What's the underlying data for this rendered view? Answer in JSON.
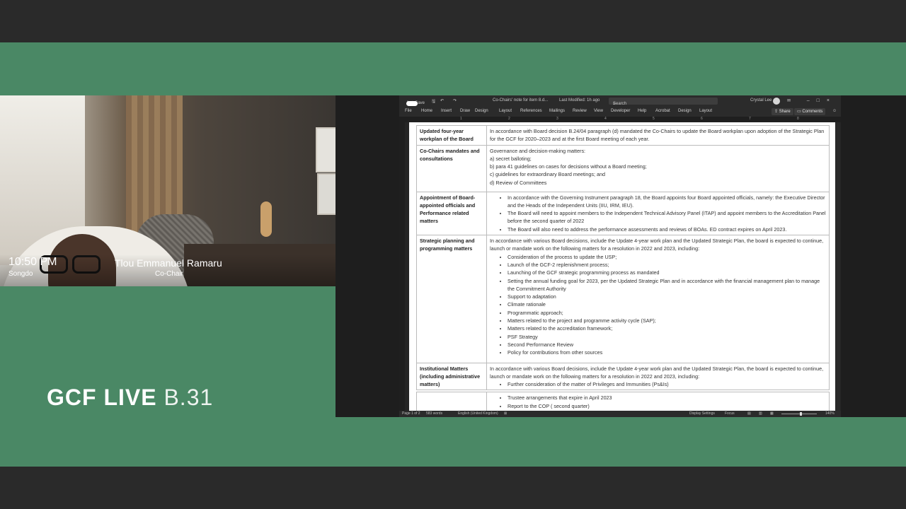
{
  "video": {
    "time": "10:50 PM",
    "city": "Songdo",
    "name": "Tlou Emmanuel Ramaru",
    "role": "Co-Chair"
  },
  "brand": {
    "main": "GCF LIVE",
    "suffix": "B.31"
  },
  "word": {
    "autosave": "AutoSave",
    "toggle": "On",
    "doc_title": "Co-Chairs' note for item 8.d...",
    "last_modified": "Last Modified: 1h ago",
    "search": "Search",
    "user": "Crystal Lee",
    "menus": [
      "File",
      "Home",
      "Insert",
      "Draw",
      "Design",
      "Layout",
      "References",
      "Mailings",
      "Review",
      "View",
      "Developer",
      "Help",
      "Acrobat",
      "Design",
      "Layout"
    ],
    "share": "Share",
    "comments": "Comments",
    "ruler_numbers": [
      "1",
      "2",
      "3",
      "4",
      "5",
      "6",
      "7",
      "8"
    ],
    "status": {
      "page": "Page 1 of 2",
      "words": "583 words",
      "language": "English (United Kingdom)",
      "display": "Display Settings",
      "focus": "Focus",
      "zoom": "140%"
    }
  },
  "doc": {
    "rows": [
      {
        "heading": "Updated four-year workplan of the Board",
        "text": "In accordance with Board decision B.24/04 paragraph (d) mandated the Co-Chairs to update the Board workplan upon adoption of the Strategic Plan for the GCF for 2020–2023 and at the first Board meeting of each year."
      },
      {
        "heading": "Co-Chairs mandates and consultations",
        "lines": [
          "Governance and decision-making matters:",
          "a) secret balloting;",
          "b) para 41 guidelines on cases for decisions without a Board meeting;",
          "c) guidelines for extraordinary Board meetings; and",
          "d) Review of Committees"
        ]
      },
      {
        "heading": "Appointment of Board-appointed officials and Performance related matters",
        "bullets": [
          "In accordance with the Governing Instrument paragraph 18, the Board appoints four Board appointed officials, namely: the Executive Director and the Heads of the Independent Units (IIU, IRM, IEU).",
          "The Board will need to appoint members to the Independent Technical Advisory Panel (ITAP) and appoint members to the Accreditation Panel before the second quarter of 2022",
          "The Board will also need to address the performance assessments and reviews of BOAs. ED contract expires on April 2023."
        ]
      },
      {
        "heading": "Strategic planning and programming matters",
        "text": "In accordance with various Board decisions, include the Update 4-year work plan and the Updated Strategic Plan, the board is expected to continue, launch or mandate work on the following matters for a resolution in 2022 and 2023, including:",
        "bullets": [
          "Consideration of the process to update the USP;",
          "Launch of the GCF-2 replenishment process;",
          "Launching of the GCF strategic programming process as mandated",
          "Setting the annual funding goal for 2023, per the Updated Strategic Plan and in accordance with the financial management plan to manage the Commitment Authority",
          "Support to adaptation",
          "Climate rationale",
          "Programmatic approach;",
          "Matters related to the project and programme activity cycle (SAP);",
          "Matters related to the accreditation framework;",
          "PSF Strategy",
          "Second Performance Review",
          "Policy for contributions from other sources"
        ]
      },
      {
        "heading": "Institutional Matters (including administrative matters)",
        "text": "In accordance with various Board decisions, include the Update 4-year work plan and the Updated Strategic Plan, the board is expected to continue, launch or mandate work on the following matters for a resolution in 2022 and 2023, including:",
        "bullets": [
          "Further consideration of the matter of Privileges and Immunities (Ps&Is)"
        ]
      },
      {
        "heading": "",
        "bullets": [
          "Trustee arrangements that expire in April 2023",
          "Report to the COP ( second quarter)"
        ]
      }
    ]
  }
}
